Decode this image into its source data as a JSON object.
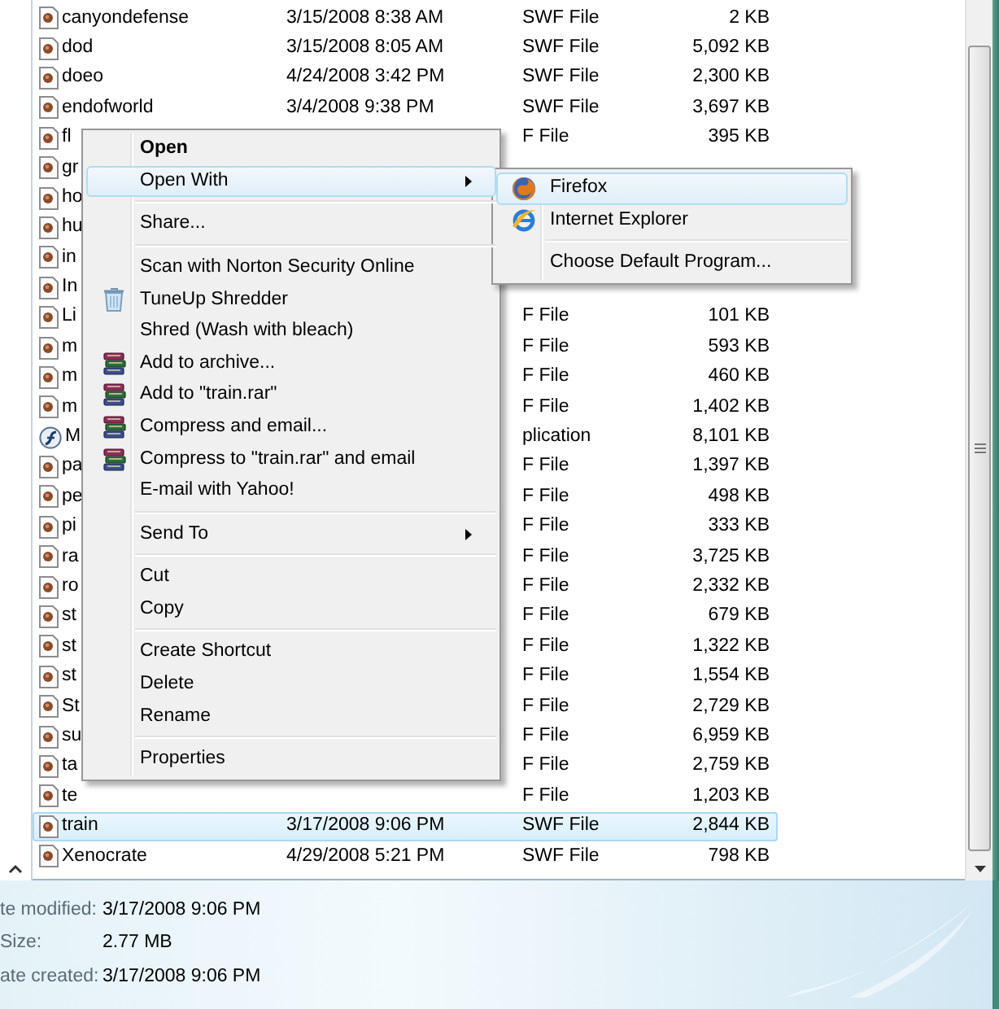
{
  "files": [
    {
      "name": "canyondefense",
      "date": "3/15/2008 8:38 AM",
      "type": "SWF File",
      "size": "2 KB",
      "kind": "swf",
      "selected": false
    },
    {
      "name": "dod",
      "date": "3/15/2008 8:05 AM",
      "type": "SWF File",
      "size": "5,092 KB",
      "kind": "swf",
      "selected": false
    },
    {
      "name": "doeo",
      "date": "4/24/2008 3:42 PM",
      "type": "SWF File",
      "size": "2,300 KB",
      "kind": "swf",
      "selected": false
    },
    {
      "name": "endofworld",
      "date": "3/4/2008 9:38 PM",
      "type": "SWF File",
      "size": "3,697 KB",
      "kind": "swf",
      "selected": false
    },
    {
      "name": "fl",
      "type": "F File",
      "size": "395 KB",
      "kind": "swf",
      "selected": false
    },
    {
      "name": "gr",
      "kind": "swf",
      "selected": false
    },
    {
      "name": "ho",
      "kind": "swf",
      "selected": false
    },
    {
      "name": "hu",
      "kind": "swf",
      "selected": false
    },
    {
      "name": "in",
      "kind": "swf",
      "selected": false
    },
    {
      "name": "In",
      "kind": "swf",
      "selected": false
    },
    {
      "name": "Li",
      "type": "F File",
      "size": "101 KB",
      "kind": "swf",
      "selected": false
    },
    {
      "name": "m",
      "type": "F File",
      "size": "593 KB",
      "kind": "swf",
      "selected": false
    },
    {
      "name": "m",
      "type": "F File",
      "size": "460 KB",
      "kind": "swf",
      "selected": false
    },
    {
      "name": "m",
      "type": "F File",
      "size": "1,402 KB",
      "kind": "swf",
      "selected": false
    },
    {
      "name": "M",
      "type": "plication",
      "size": "8,101 KB",
      "kind": "application",
      "selected": false
    },
    {
      "name": "pa",
      "type": "F File",
      "size": "1,397 KB",
      "kind": "swf",
      "selected": false
    },
    {
      "name": "pe",
      "type": "F File",
      "size": "498 KB",
      "kind": "swf",
      "selected": false
    },
    {
      "name": "pi",
      "type": "F File",
      "size": "333 KB",
      "kind": "swf",
      "selected": false
    },
    {
      "name": "ra",
      "type": "F File",
      "size": "3,725 KB",
      "kind": "swf",
      "selected": false
    },
    {
      "name": "ro",
      "type": "F File",
      "size": "2,332 KB",
      "kind": "swf",
      "selected": false
    },
    {
      "name": "st",
      "type": "F File",
      "size": "679 KB",
      "kind": "swf",
      "selected": false
    },
    {
      "name": "st",
      "type": "F File",
      "size": "1,322 KB",
      "kind": "swf",
      "selected": false
    },
    {
      "name": "st",
      "type": "F File",
      "size": "1,554 KB",
      "kind": "swf",
      "selected": false
    },
    {
      "name": "St",
      "type": "F File",
      "size": "2,729 KB",
      "kind": "swf",
      "selected": false
    },
    {
      "name": "su",
      "type": "F File",
      "size": "6,959 KB",
      "kind": "swf",
      "selected": false
    },
    {
      "name": "ta",
      "type": "F File",
      "size": "2,759 KB",
      "kind": "swf",
      "selected": false
    },
    {
      "name": "te",
      "type": "F File",
      "size": "1,203 KB",
      "kind": "swf",
      "selected": false
    },
    {
      "name": "train",
      "date": "3/17/2008 9:06 PM",
      "type": "SWF File",
      "size": "2,844 KB",
      "kind": "swf",
      "selected": true
    },
    {
      "name": "Xenocrate",
      "date": "4/29/2008 5:21 PM",
      "type": "SWF File",
      "size": "798 KB",
      "kind": "swf",
      "selected": false
    }
  ],
  "context_menu": {
    "groups": [
      [
        {
          "label": "Open",
          "kind": "command",
          "default": true,
          "selected": false,
          "has_submenu": false
        },
        {
          "label": "Open With",
          "kind": "command",
          "default": false,
          "selected": true,
          "has_submenu": true
        }
      ],
      [
        {
          "label": "Share...",
          "kind": "command",
          "default": false,
          "selected": false,
          "has_submenu": false
        }
      ],
      [
        {
          "label": "Scan with Norton Security Online",
          "kind": "command",
          "default": false,
          "selected": false,
          "has_submenu": false
        },
        {
          "label": "TuneUp Shredder",
          "kind": "shredder",
          "default": false,
          "selected": false,
          "has_submenu": false
        },
        {
          "label": "Shred (Wash with bleach)",
          "kind": "command",
          "default": false,
          "selected": false,
          "has_submenu": false
        },
        {
          "label": "Add to archive...",
          "kind": "archive",
          "default": false,
          "selected": false,
          "has_submenu": false
        },
        {
          "label": "Add to \"train.rar\"",
          "kind": "archive",
          "default": false,
          "selected": false,
          "has_submenu": false
        },
        {
          "label": "Compress and email...",
          "kind": "archive",
          "default": false,
          "selected": false,
          "has_submenu": false
        },
        {
          "label": "Compress to \"train.rar\" and email",
          "kind": "archive",
          "default": false,
          "selected": false,
          "has_submenu": false
        },
        {
          "label": "E-mail with Yahoo!",
          "kind": "command",
          "default": false,
          "selected": false,
          "has_submenu": false
        }
      ],
      [
        {
          "label": "Send To",
          "kind": "command",
          "default": false,
          "selected": false,
          "has_submenu": true
        }
      ],
      [
        {
          "label": "Cut",
          "kind": "command",
          "default": false,
          "selected": false,
          "has_submenu": false
        },
        {
          "label": "Copy",
          "kind": "command",
          "default": false,
          "selected": false,
          "has_submenu": false
        }
      ],
      [
        {
          "label": "Create Shortcut",
          "kind": "command",
          "default": false,
          "selected": false,
          "has_submenu": false
        },
        {
          "label": "Delete",
          "kind": "command",
          "default": false,
          "selected": false,
          "has_submenu": false
        },
        {
          "label": "Rename",
          "kind": "command",
          "default": false,
          "selected": false,
          "has_submenu": false
        }
      ],
      [
        {
          "label": "Properties",
          "kind": "command",
          "default": false,
          "selected": false,
          "has_submenu": false
        }
      ]
    ]
  },
  "open_with_menu": {
    "groups": [
      [
        {
          "label": "Firefox",
          "kind": "fox",
          "selected": true
        },
        {
          "label": "Internet Explorer",
          "kind": "ring",
          "selected": false
        }
      ],
      [
        {
          "label": "Choose Default Program...",
          "kind": "command",
          "selected": false
        }
      ]
    ]
  },
  "details": [
    {
      "label": "te modified:",
      "value": "3/17/2008 9:06 PM"
    },
    {
      "label": "Size:",
      "value": "2.77 MB"
    },
    {
      "label": "ate created:",
      "value": "3/17/2008 9:06 PM"
    }
  ]
}
